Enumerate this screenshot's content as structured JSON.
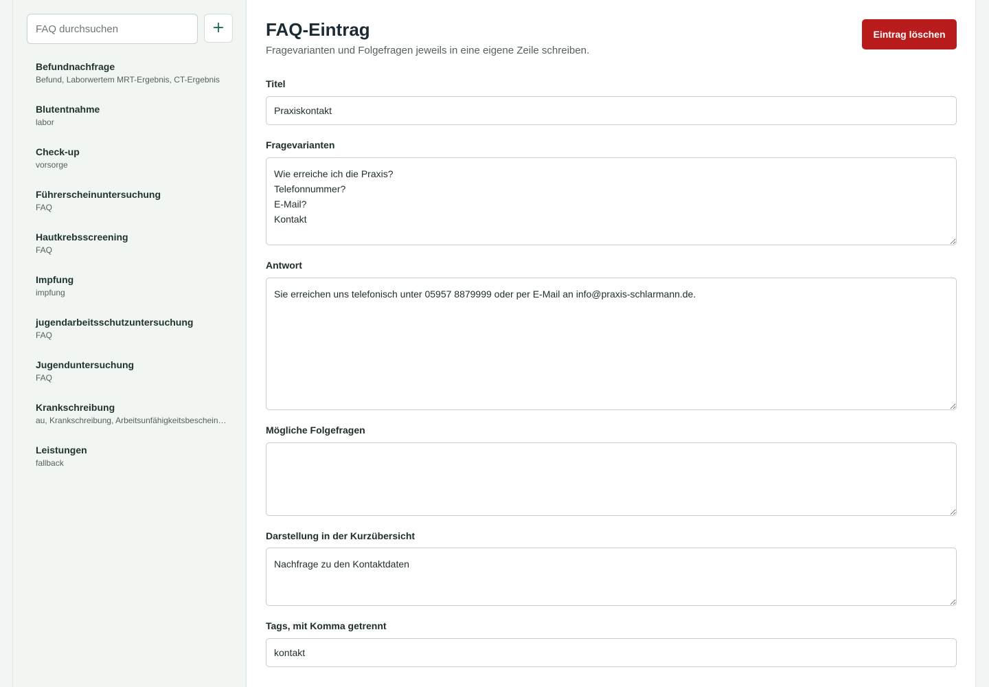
{
  "sidebar": {
    "search_placeholder": "FAQ durchsuchen",
    "add_label": "+",
    "items": [
      {
        "title": "Befundnachfrage",
        "tags": "Befund, Laborwertem MRT-Ergebnis, CT-Ergebnis"
      },
      {
        "title": "Blutentnahme",
        "tags": "labor"
      },
      {
        "title": "Check-up",
        "tags": "vorsorge"
      },
      {
        "title": "Führerscheinuntersuchung",
        "tags": "FAQ"
      },
      {
        "title": "Hautkrebsscreening",
        "tags": "FAQ"
      },
      {
        "title": "Impfung",
        "tags": "impfung"
      },
      {
        "title": "jugendarbeitsschutzuntersuchung",
        "tags": "FAQ"
      },
      {
        "title": "Jugenduntersuchung",
        "tags": "FAQ"
      },
      {
        "title": "Krankschreibung",
        "tags": "au, Krankschreibung, Arbeitsunfähigkeitsbescheinigung"
      },
      {
        "title": "Leistungen",
        "tags": "fallback"
      }
    ]
  },
  "main": {
    "title": "FAQ-Eintrag",
    "subtitle": "Fragevarianten und Folgefragen jeweils in eine eigene Zeile schreiben.",
    "delete_label": "Eintrag löschen",
    "fields": {
      "titel": {
        "label": "Titel",
        "value": "Praxiskontakt"
      },
      "fragevarianten": {
        "label": "Fragevarianten",
        "value": "Wie erreiche ich die Praxis?\nTelefonnummer?\nE-Mail?\nKontakt"
      },
      "antwort": {
        "label": "Antwort",
        "value": "Sie erreichen uns telefonisch unter 05957 8879999 oder per E-Mail an info@praxis-schlarmann.de."
      },
      "folgefragen": {
        "label": "Mögliche Folgefragen",
        "value": ""
      },
      "kurzuebersicht": {
        "label": "Darstellung in der Kurzübersicht",
        "value": "Nachfrage zu den Kontaktdaten"
      },
      "tags": {
        "label": "Tags, mit Komma getrennt",
        "value": "kontakt"
      }
    }
  },
  "colors": {
    "delete_button": "#b91c1c",
    "accent": "#1d6b4f",
    "sidebar_bg": "#f2f6f3"
  }
}
